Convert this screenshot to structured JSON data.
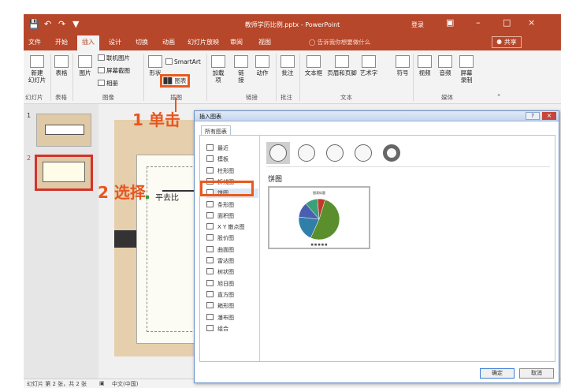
{
  "titlebar": {
    "document_title": "教师学历比例.pptx - PowerPoint",
    "login": "登录",
    "undo_icon": "undo-icon",
    "redo_icon": "redo-icon"
  },
  "tabs": [
    "文件",
    "开始",
    "插入",
    "设计",
    "切换",
    "动画",
    "幻灯片放映",
    "审阅",
    "视图"
  ],
  "active_tab": "插入",
  "tell_me": "告诉我你想要做什么",
  "share": "共享",
  "ribbon": {
    "new_slide": "新建\n幻灯片",
    "table": "表格",
    "image": "图片",
    "online_image": "联机图片",
    "screenshot": "屏幕截图",
    "album": "相册",
    "shapes": "形状",
    "smartart": "SmartArt",
    "chart": "图表",
    "addins": "加载\n项",
    "link": "链\n接",
    "action": "动作",
    "comment": "批注",
    "textbox": "文本框",
    "header_footer": "页眉和页脚",
    "wordart": "艺术字",
    "symbol": "符号",
    "video": "视频",
    "audio": "音频",
    "screen_record": "屏幕\n录制",
    "groups": {
      "slides": "幻灯片",
      "tables": "表格",
      "images": "图像",
      "illustrations": "插图",
      "links": "链接",
      "comments": "批注",
      "text": "文本",
      "media": "媒体"
    }
  },
  "annotations": {
    "step1": "1 单击",
    "step2": "2 选择"
  },
  "thumbnails": {
    "num1": "1",
    "num2": "2"
  },
  "slide": {
    "text": "平去比"
  },
  "statusbar": {
    "slide_info": "幻灯片 第 2 张，共 2 张",
    "language": "中文(中国)"
  },
  "dialog": {
    "title": "插入图表",
    "tab": "所有图表",
    "categories": [
      "最近",
      "模板",
      "柱形图",
      "折线图",
      "饼图",
      "条形图",
      "面积图",
      "X Y 散点图",
      "股价图",
      "曲面图",
      "雷达图",
      "树状图",
      "旭日图",
      "直方图",
      "箱形图",
      "瀑布图",
      "组合"
    ],
    "selected_category": "饼图",
    "type_name": "饼图",
    "preview_title": "图表标题",
    "ok": "确定",
    "cancel": "取消",
    "help": "?",
    "close": "×"
  },
  "colors": {
    "accent": "#b7472a",
    "annotation": "#e8561f",
    "pie": [
      "#5b8f2e",
      "#2f7fa8",
      "#4a5fb0",
      "#3aa07a",
      "#c0392b"
    ]
  },
  "pie_preview": {
    "values": [
      52,
      20,
      12,
      10,
      6
    ]
  }
}
